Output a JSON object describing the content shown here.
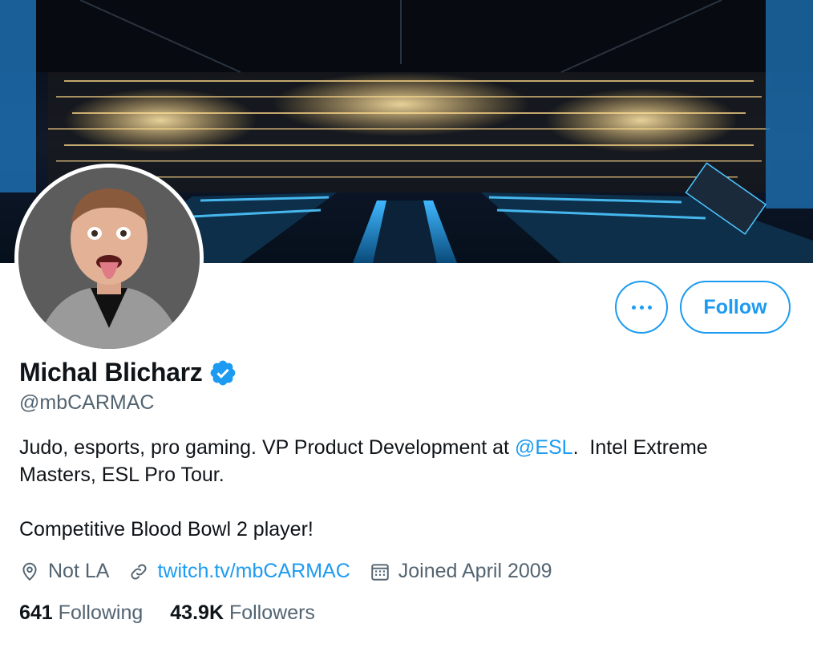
{
  "profile": {
    "display_name": "Michal Blicharz",
    "handle": "@mbCARMAC",
    "verified": true,
    "bio": {
      "line1_prefix": "Judo, esports, pro gaming. VP Product Development at ",
      "line1_mention": "@ESL",
      "line1_suffix": ".  Intel Extreme",
      "line2": "Masters, ESL Pro Tour.",
      "line3": "Competitive Blood Bowl 2 player!"
    },
    "location": "Not LA",
    "website": "twitch.tv/mbCARMAC",
    "joined": "Joined April 2009",
    "following_count": "641",
    "following_label": "Following",
    "followers_count": "43.9K",
    "followers_label": "Followers"
  },
  "actions": {
    "follow_label": "Follow",
    "more_icon": "more-dots-icon"
  },
  "icons": {
    "verified": "verified-badge-icon",
    "location": "location-pin-icon",
    "link": "link-icon",
    "calendar": "calendar-icon"
  },
  "colors": {
    "accent": "#1d9bf0",
    "text_primary": "#0f1419",
    "text_secondary": "#536471"
  }
}
